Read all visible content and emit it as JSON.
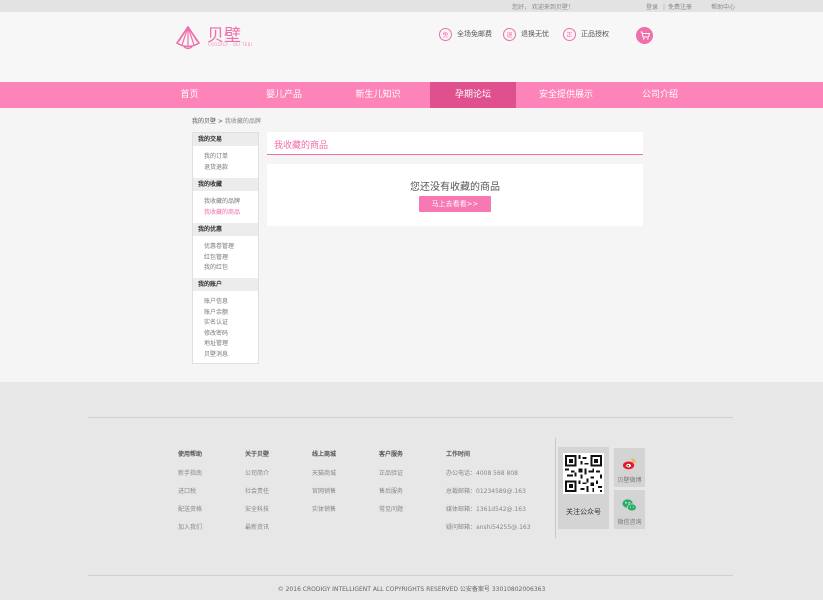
{
  "topbar": {
    "greeting": "您好，  欢迎来到贝壁！",
    "links": [
      "登录",
      "|",
      "免费注册",
      "帮助中心"
    ]
  },
  "header": {
    "logo_text": "贝壁",
    "logo_sub": "CRODIGY · BEI TEBI",
    "features": [
      {
        "icon": "shipping-icon",
        "glyph": "免",
        "label": "全场免邮费"
      },
      {
        "icon": "return-icon",
        "glyph": "退",
        "label": "退换无忧"
      },
      {
        "icon": "genuine-icon",
        "glyph": "正",
        "label": "正品授权"
      }
    ]
  },
  "nav": {
    "items": [
      "首页",
      "婴儿产品",
      "新生儿知识",
      "孕期论坛",
      "安全提供展示",
      "公司介绍"
    ],
    "active_index": 3
  },
  "breadcrumb": {
    "root": "我的贝壁",
    "sep": " > ",
    "current": "我收藏的品牌"
  },
  "sidebar": {
    "groups": [
      {
        "title": "我的交易",
        "items": [
          "我的订单",
          "退货退款"
        ]
      },
      {
        "title": "我的收藏",
        "items": [
          "我收藏的品牌",
          "我收藏的商品"
        ]
      },
      {
        "title": "我的优惠",
        "items": [
          "优惠卷管理",
          "红包管理",
          "我的红包"
        ]
      },
      {
        "title": "我的账户",
        "items": [
          "账户信息",
          "账户余额",
          "实名认证",
          "修改密码",
          "地址管理",
          "贝壁消息"
        ]
      }
    ],
    "active_item": "我收藏的商品"
  },
  "main": {
    "title": "我收藏的商品",
    "empty_message": "您还没有收藏的商品",
    "button_label": "马上去看看>>"
  },
  "footer": {
    "columns": [
      {
        "title": "使用帮助",
        "links": [
          "新手指南",
          "进口税",
          "配送资格",
          "加入我们"
        ]
      },
      {
        "title": "关于贝壁",
        "links": [
          "公司简介",
          "社会责任",
          "安全科技",
          "最新资讯"
        ]
      },
      {
        "title": "线上商城",
        "links": [
          "天猫商城",
          "官网销售",
          "实体销售"
        ]
      },
      {
        "title": "客户服务",
        "links": [
          "正品验证",
          "售后服务",
          "常见问题"
        ]
      },
      {
        "title": "工作时间",
        "links": [
          "办公电话：4008 568 808",
          "总裁邮箱：01234589@.163",
          "媒体邮箱：1361d542@.163",
          "疑问邮箱：anshi54255@.163"
        ]
      }
    ],
    "qr_label": "关注公众号",
    "social": [
      {
        "icon": "weibo-icon",
        "label": "贝壁微博"
      },
      {
        "icon": "wechat-icon",
        "label": "微信咨询"
      }
    ],
    "copyright": "©  2016  CRODIGY INTELLIGENT ALL COPYRIGHTS RESERVED    公安备案号 33010802006363"
  },
  "colors": {
    "brand_pink": "#f06eaa",
    "nav_pink": "#fd84b8",
    "nav_active": "#e0508f"
  }
}
